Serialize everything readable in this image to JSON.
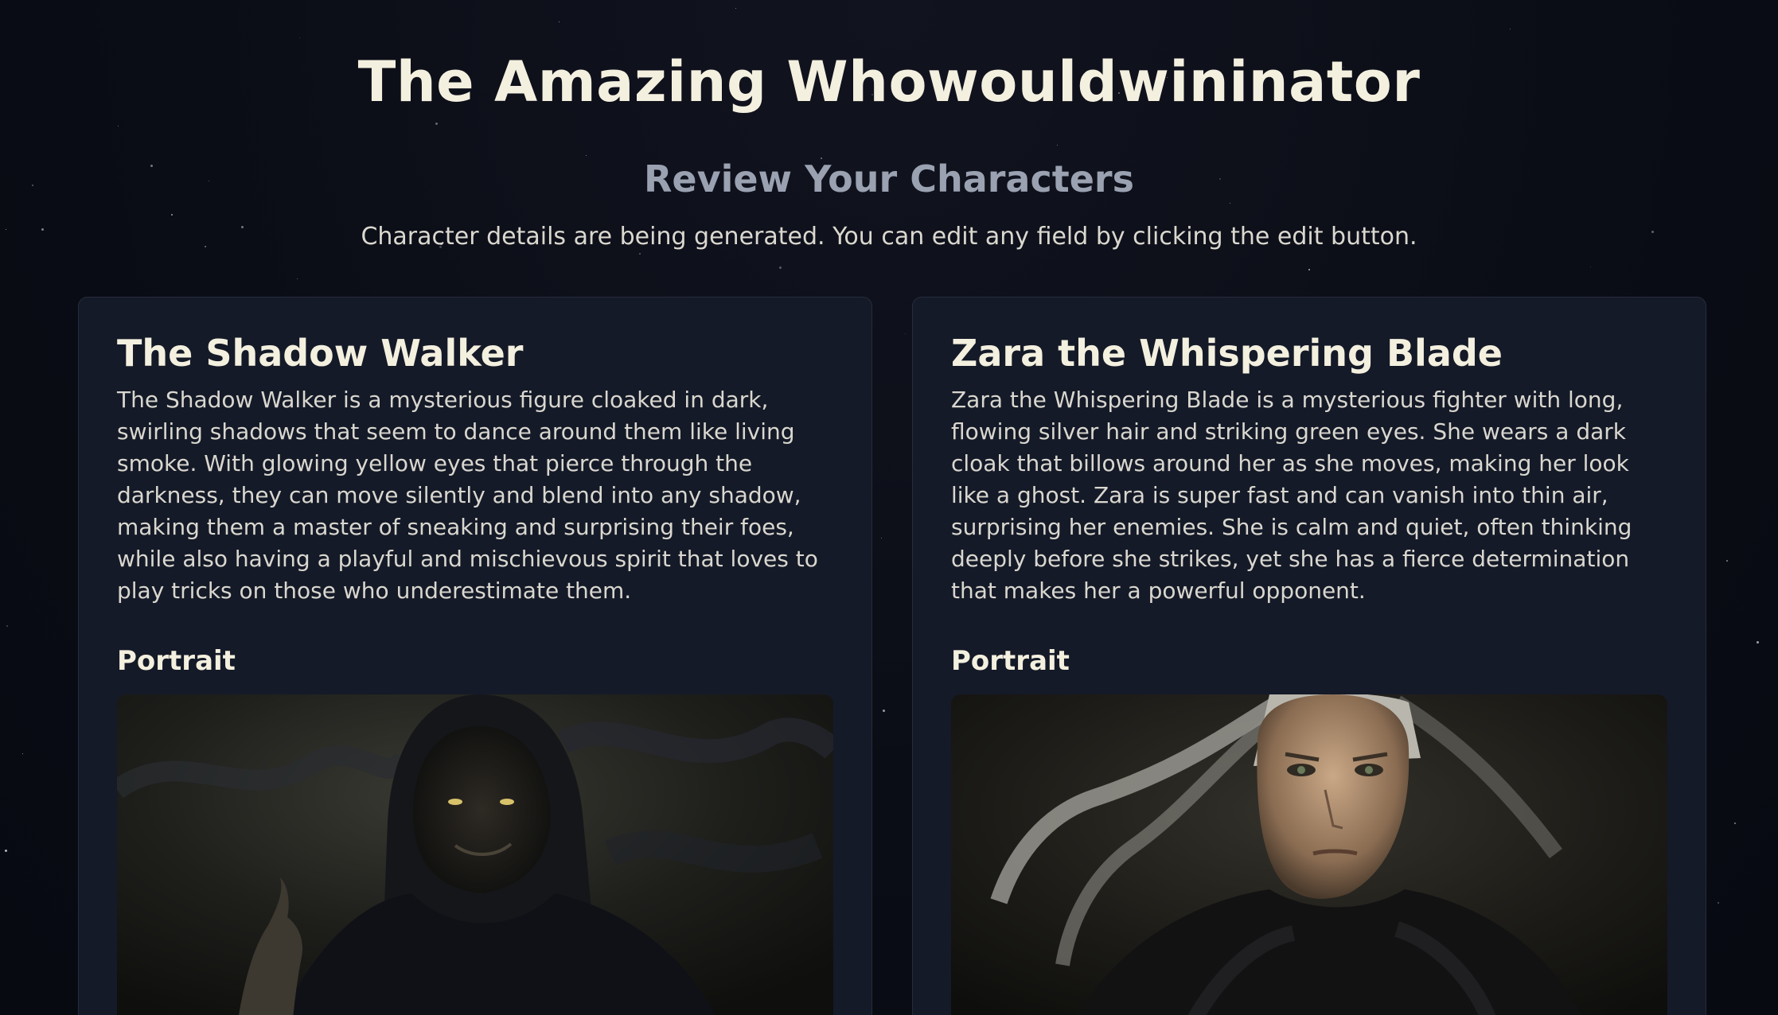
{
  "app": {
    "title": "The Amazing Whowouldwininator"
  },
  "review": {
    "heading": "Review Your Characters",
    "instructions": "Character details are being generated. You can edit any field by clicking the edit button."
  },
  "characters": [
    {
      "name": "The Shadow Walker",
      "description": "The Shadow Walker is a mysterious figure cloaked in dark, swirling shadows that seem to dance around them like living smoke. With glowing yellow eyes that pierce through the darkness, they can move silently and blend into any shadow, making them a master of sneaking and surprising their foes, while also having a playful and mischievous spirit that loves to play tricks on those who underestimate them.",
      "portrait_label": "Portrait",
      "portrait_icon": "hooded-shadow-figure"
    },
    {
      "name": "Zara the Whispering Blade",
      "description": "Zara the Whispering Blade is a mysterious fighter with long, flowing silver hair and striking green eyes. She wears a dark cloak that billows around her as she moves, making her look like a ghost. Zara is super fast and can vanish into thin air, surprising her enemies. She is calm and quiet, often thinking deeply before she strikes, yet she has a fierce determination that makes her a powerful opponent.",
      "portrait_label": "Portrait",
      "portrait_icon": "silver-haired-woman"
    }
  ],
  "colors": {
    "background": "#0b0d16",
    "card": "#151a28",
    "title": "#f4f0df",
    "subheading": "#9aa1b1"
  }
}
